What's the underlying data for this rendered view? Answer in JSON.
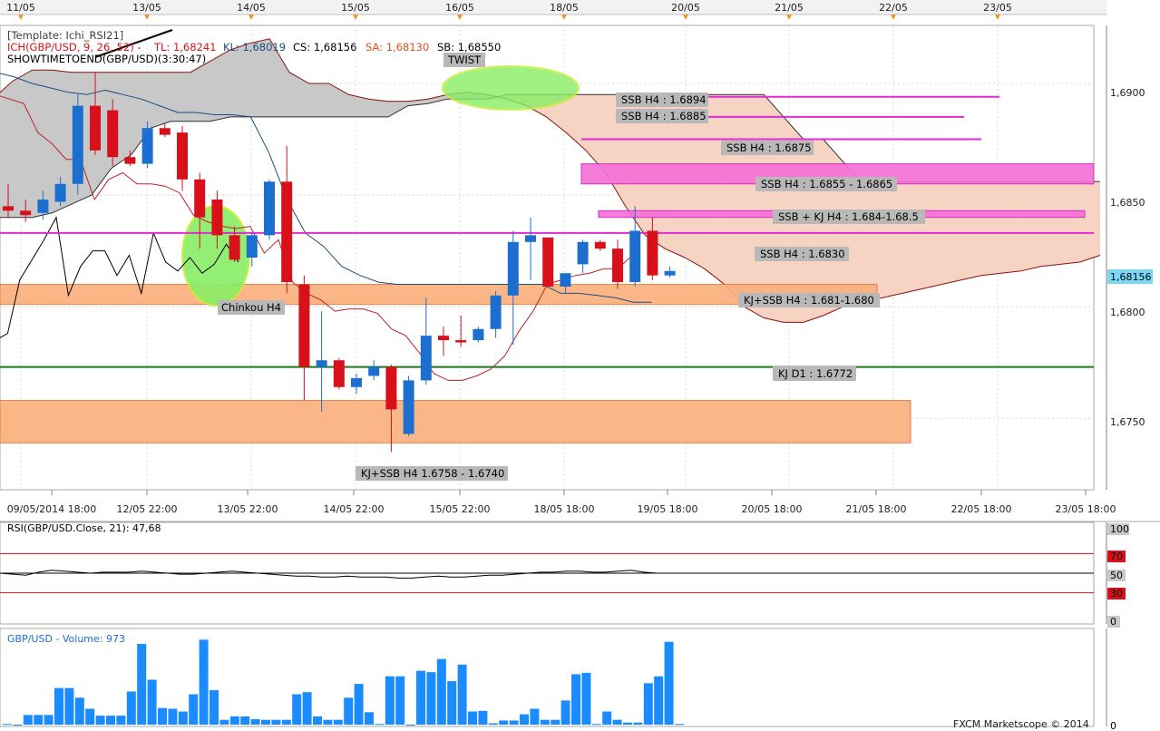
{
  "header": {
    "template": "[Template: Ichi_RSI21]",
    "ich_label": "ICH(GBP/USD, 9, 26, 52) -",
    "tl": "TL: 1,68241",
    "kl": "KL: 1,68019",
    "cs": "CS: 1,68156",
    "sa": "SA: 1,68130",
    "sb": "SB: 1,68550",
    "showtime": "SHOWTIMETOEND(GBP/USD)(3:30:47)"
  },
  "colors": {
    "bull": "#1d6fcf",
    "bear": "#d8101a",
    "tenkan": "#c0202a",
    "kijun": "#1a4d80",
    "chikou": "#000000",
    "cloud_bull": "#c8c8c8",
    "cloud_bear": "#f7d3c4",
    "orange_zone": "#fbb07e",
    "magenta": "#e02ad2",
    "pink_zone": "#f572d6",
    "green_line": "#1a7a1a",
    "green_ellipse": "#88ee66",
    "volume": "#1a8cff",
    "price_tag_bg": "#7ad8f7"
  },
  "top_dates": [
    "11/05",
    "13/05",
    "14/05",
    "15/05",
    "16/05",
    "18/05",
    "20/05",
    "21/05",
    "22/05",
    "23/05"
  ],
  "bottom_dates": [
    "09/05/2014 18:00",
    "12/05 22:00",
    "13/05 22:00",
    "14/05 22:00",
    "15/05 22:00",
    "18/05 18:00",
    "19/05 18:00",
    "20/05 18:00",
    "21/05 18:00",
    "22/05 18:00",
    "23/05 18:00"
  ],
  "price_axis": {
    "ticks": [
      "1,6900",
      "1,6850",
      "1,6800",
      "1,6750"
    ],
    "current": "1,68156"
  },
  "annotations": {
    "twist": "TWIST",
    "ssb_6894": "SSB H4 : 1.6894",
    "ssb_6885": "SSB H4 : 1.6885",
    "ssb_6875": "SSB H4 : 1.6875",
    "ssb_zone": "SSB H4 : 1.6855 - 1.6865",
    "ssb_kj": "SSB + KJ H4 : 1.684-1.68.5",
    "ssb_6830": "SSB H4 : 1.6830",
    "kj_ssb_681": "KJ+SSB H4 : 1.681-1.680",
    "kj_d1": "KJ D1 : 1.6772",
    "kj_ssb_6758": "KJ+SSB H4 1.6758 - 1.6740",
    "chikou": "Chinkou H4"
  },
  "rsi": {
    "label": "RSI(GBP/USD.Close, 21): 47,68",
    "levels": [
      "100",
      "70",
      "50",
      "30",
      "0"
    ]
  },
  "volume": {
    "label": "GBP/USD - Volume: 973"
  },
  "footer": {
    "copyright": "FXCM Marketscope © 2014"
  },
  "chart_data": {
    "type": "candlestick",
    "symbol": "GBP/USD",
    "ylim": [
      1.6718,
      1.6926
    ],
    "candles": [
      {
        "o": 1.6845,
        "h": 1.6855,
        "l": 1.684,
        "c": 1.6843
      },
      {
        "o": 1.6843,
        "h": 1.6848,
        "l": 1.6838,
        "c": 1.6841
      },
      {
        "o": 1.6842,
        "h": 1.6852,
        "l": 1.6839,
        "c": 1.6848
      },
      {
        "o": 1.6847,
        "h": 1.6858,
        "l": 1.6845,
        "c": 1.6855
      },
      {
        "o": 1.6855,
        "h": 1.6895,
        "l": 1.685,
        "c": 1.689
      },
      {
        "o": 1.689,
        "h": 1.6905,
        "l": 1.6868,
        "c": 1.687
      },
      {
        "o": 1.6888,
        "h": 1.6893,
        "l": 1.6863,
        "c": 1.6867
      },
      {
        "o": 1.6867,
        "h": 1.687,
        "l": 1.6863,
        "c": 1.6864
      },
      {
        "o": 1.6864,
        "h": 1.6883,
        "l": 1.6862,
        "c": 1.688
      },
      {
        "o": 1.688,
        "h": 1.6882,
        "l": 1.6876,
        "c": 1.6877
      },
      {
        "o": 1.6878,
        "h": 1.6881,
        "l": 1.6852,
        "c": 1.6857
      },
      {
        "o": 1.6857,
        "h": 1.686,
        "l": 1.6826,
        "c": 1.684
      },
      {
        "o": 1.6848,
        "h": 1.6852,
        "l": 1.6826,
        "c": 1.6832
      },
      {
        "o": 1.6832,
        "h": 1.6836,
        "l": 1.682,
        "c": 1.6821
      },
      {
        "o": 1.6822,
        "h": 1.6833,
        "l": 1.6818,
        "c": 1.6832
      },
      {
        "o": 1.6832,
        "h": 1.6857,
        "l": 1.683,
        "c": 1.6856
      },
      {
        "o": 1.6856,
        "h": 1.6872,
        "l": 1.6806,
        "c": 1.6811
      },
      {
        "o": 1.681,
        "h": 1.6814,
        "l": 1.6758,
        "c": 1.6773
      },
      {
        "o": 1.6773,
        "h": 1.6798,
        "l": 1.6753,
        "c": 1.6776
      },
      {
        "o": 1.6776,
        "h": 1.6777,
        "l": 1.6763,
        "c": 1.6764
      },
      {
        "o": 1.6764,
        "h": 1.677,
        "l": 1.6761,
        "c": 1.6768
      },
      {
        "o": 1.6769,
        "h": 1.6776,
        "l": 1.6767,
        "c": 1.6773
      },
      {
        "o": 1.6773,
        "h": 1.6774,
        "l": 1.6735,
        "c": 1.6754
      },
      {
        "o": 1.6743,
        "h": 1.6769,
        "l": 1.6742,
        "c": 1.6767
      },
      {
        "o": 1.6767,
        "h": 1.6804,
        "l": 1.6765,
        "c": 1.6787
      },
      {
        "o": 1.6787,
        "h": 1.6791,
        "l": 1.6778,
        "c": 1.6785
      },
      {
        "o": 1.6785,
        "h": 1.6796,
        "l": 1.6782,
        "c": 1.6784
      },
      {
        "o": 1.6785,
        "h": 1.6791,
        "l": 1.6784,
        "c": 1.679
      },
      {
        "o": 1.679,
        "h": 1.6807,
        "l": 1.6786,
        "c": 1.6805
      },
      {
        "o": 1.6805,
        "h": 1.6834,
        "l": 1.6783,
        "c": 1.6829
      },
      {
        "o": 1.6829,
        "h": 1.684,
        "l": 1.6812,
        "c": 1.6832
      },
      {
        "o": 1.6831,
        "h": 1.6831,
        "l": 1.6809,
        "c": 1.6809
      },
      {
        "o": 1.6809,
        "h": 1.6815,
        "l": 1.6806,
        "c": 1.6815
      },
      {
        "o": 1.6819,
        "h": 1.683,
        "l": 1.6815,
        "c": 1.6829
      },
      {
        "o": 1.6829,
        "h": 1.683,
        "l": 1.6825,
        "c": 1.6826
      },
      {
        "o": 1.6826,
        "h": 1.683,
        "l": 1.6808,
        "c": 1.6811
      },
      {
        "o": 1.6811,
        "h": 1.6845,
        "l": 1.6809,
        "c": 1.6834
      },
      {
        "o": 1.6834,
        "h": 1.684,
        "l": 1.6812,
        "c": 1.6814
      },
      {
        "o": 1.6814,
        "h": 1.6818,
        "l": 1.6813,
        "c": 1.6816
      }
    ],
    "tenkan": [
      1.6895,
      1.6893,
      1.6891,
      1.6878,
      1.6873,
      1.6866,
      1.6866,
      1.6848,
      1.6857,
      1.686,
      1.6855,
      1.6855,
      1.6854,
      1.6851,
      1.6841,
      1.6838,
      1.6836,
      1.6835,
      1.6836,
      1.6824,
      1.683,
      1.6811,
      1.6806,
      1.6803,
      1.6798,
      1.6799,
      1.6799,
      1.6797,
      1.679,
      1.6787,
      1.6779,
      1.677,
      1.6767,
      1.6767,
      1.6769,
      1.6772,
      1.6778,
      1.6789,
      1.6798,
      1.681,
      1.6812,
      1.6814,
      1.6815,
      1.6817,
      1.6817,
      1.6823
    ],
    "kijun": [
      1.6905,
      1.6903,
      1.69,
      1.6898,
      1.6896,
      1.6895,
      1.6897,
      1.6895,
      1.6893,
      1.689,
      1.6887,
      1.6887,
      1.6886,
      1.6886,
      1.6885,
      1.6869,
      1.6848,
      1.6833,
      1.6827,
      1.6818,
      1.6814,
      1.6811,
      1.681,
      1.681,
      1.681,
      1.681,
      1.681,
      1.681,
      1.681,
      1.681,
      1.681,
      1.6806,
      1.6806,
      1.6805,
      1.6804,
      1.6802,
      1.6802
    ],
    "chikou": [
      1.6785,
      1.6788,
      1.6812,
      1.6821,
      1.683,
      1.684,
      1.6805,
      1.6818,
      1.6825,
      1.6825,
      1.6814,
      1.6823,
      1.6806,
      1.6833,
      1.682,
      1.6816,
      1.6822,
      1.6815,
      1.6819,
      1.6828,
      1.682
    ],
    "senkou_a": [
      1.6893,
      1.6901,
      1.6906,
      1.6906,
      1.6905,
      1.6905,
      1.6905,
      1.6905,
      1.6905,
      1.6905,
      1.6905,
      1.691,
      1.6915,
      1.6918,
      1.692,
      1.6905,
      1.69,
      1.69,
      1.6895,
      1.6893,
      1.6892,
      1.6892,
      1.6893,
      1.6895,
      1.6896,
      1.6895,
      1.6893,
      1.689,
      1.6885,
      1.6878,
      1.687,
      1.686,
      1.6845,
      1.6832,
      1.6826,
      1.6822,
      1.6817,
      1.681,
      1.68,
      1.6795,
      1.6793,
      1.6793,
      1.6796,
      1.68,
      1.6802,
      1.6804,
      1.6806,
      1.6808,
      1.681,
      1.6812,
      1.6814,
      1.6815,
      1.6816,
      1.6818,
      1.6819,
      1.682,
      1.6823
    ],
    "senkou_b": [
      1.684,
      1.684,
      1.684,
      1.6842,
      1.6846,
      1.685,
      1.6862,
      1.6868,
      1.688,
      1.6883,
      1.6883,
      1.6883,
      1.6885,
      1.6885,
      1.6885,
      1.6885,
      1.6885,
      1.6885,
      1.6885,
      1.6885,
      1.6885,
      1.689,
      1.6891,
      1.6893,
      1.6893,
      1.6893,
      1.6895,
      1.6895,
      1.6895,
      1.6895,
      1.6895,
      1.6895,
      1.6895,
      1.6895,
      1.6895,
      1.6895,
      1.6895,
      1.6895,
      1.6895,
      1.6895,
      1.6885,
      1.6875,
      1.6875,
      1.6865,
      1.6856,
      1.6856,
      1.6856,
      1.6856,
      1.6856,
      1.6856,
      1.6856,
      1.6856,
      1.6856,
      1.6856,
      1.6856,
      1.6856,
      1.6856
    ],
    "zones": [
      {
        "type": "orange",
        "from": 1.6801,
        "to": 1.681
      },
      {
        "type": "orange",
        "from": 1.6739,
        "to": 1.6758
      },
      {
        "type": "pink",
        "from": 1.6855,
        "to": 1.6864
      },
      {
        "type": "pink",
        "from": 1.684,
        "to": 1.6843
      }
    ],
    "levels": {
      "magenta_main": 1.6833,
      "ssb_6894": 1.6894,
      "ssb_6885": 1.6885,
      "ssb_6875": 1.6875,
      "kj_d1": 1.6773
    },
    "rsi": [
      50,
      49,
      48,
      51,
      53,
      52,
      51,
      50,
      51,
      51,
      51,
      52,
      51,
      50,
      49,
      49,
      50,
      51,
      52,
      51,
      50,
      49,
      48,
      47,
      47,
      46,
      46,
      47,
      46,
      46,
      46,
      45,
      45,
      46,
      47,
      46,
      46,
      47,
      48,
      48,
      49,
      50,
      51,
      51,
      52,
      52,
      51,
      51,
      52,
      53,
      51,
      50,
      50
    ],
    "volume": [
      1,
      0,
      14,
      14,
      14,
      53,
      53,
      39,
      23,
      13,
      13,
      13,
      48,
      117,
      65,
      24,
      23,
      19,
      44,
      123,
      50,
      7,
      12,
      12,
      8,
      7,
      7,
      7,
      44,
      47,
      12,
      7,
      7,
      39,
      59,
      18,
      1,
      70,
      70,
      0,
      78,
      76,
      95,
      63,
      87,
      19,
      20,
      2,
      6,
      6,
      15,
      23,
      7,
      7,
      35,
      73,
      75,
      1,
      19,
      7,
      3,
      3,
      60,
      70,
      120,
      1
    ],
    "volume_ylim": [
      0,
      130
    ]
  }
}
